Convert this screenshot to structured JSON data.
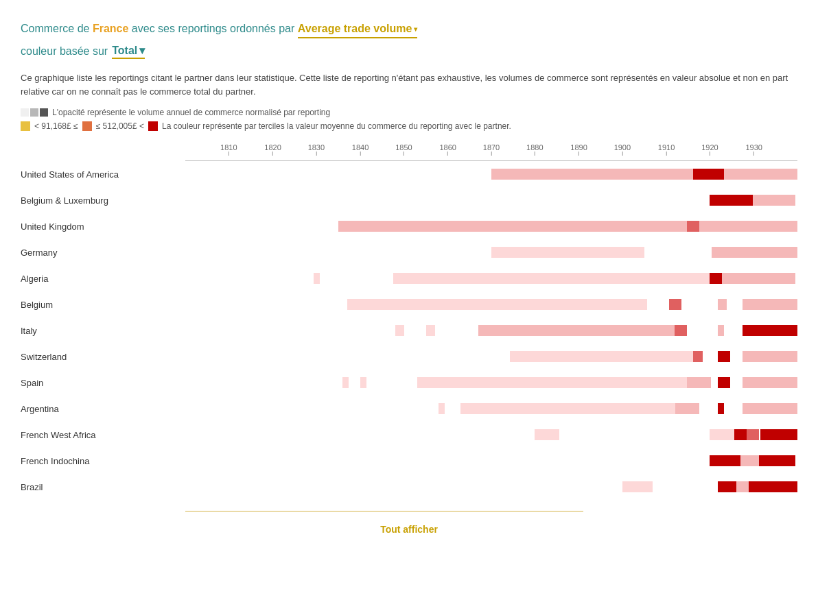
{
  "title": {
    "prefix": "Commerce de ",
    "country": "France",
    "middle": " avec ses reportings ordonnés par",
    "sort_label": "Average trade volume",
    "sort_arrow": "▾",
    "color_prefix": "couleur basée sur",
    "color_value": "Total",
    "color_arrow": "▾"
  },
  "description": "Ce graphique liste les reportings citant le partner dans leur statistique. Cette liste de reporting n'étant pas exhaustive, les volumes de commerce sont représentés en valeur absolue et non en part relative car on ne connaît pas le commerce total du partner.",
  "legend": {
    "opacity_text": "L'opacité représente le volume annuel de commerce normalisé par reporting",
    "color_text": "La couleur représente par terciles la valeur moyenne du commerce du reporting avec le partner.",
    "threshold1": "< 91,168£ ≤",
    "threshold2": "≤ 512,005£ <"
  },
  "timeline": {
    "ticks": [
      "1810",
      "1820",
      "1830",
      "1840",
      "1850",
      "1860",
      "1870",
      "1880",
      "1890",
      "1900",
      "1910",
      "1920",
      "1930"
    ]
  },
  "countries": [
    {
      "name": "United States of America"
    },
    {
      "name": "Belgium & Luxemburg"
    },
    {
      "name": "United Kingdom"
    },
    {
      "name": "Germany"
    },
    {
      "name": "Algeria"
    },
    {
      "name": "Belgium"
    },
    {
      "name": "Italy"
    },
    {
      "name": "Switzerland"
    },
    {
      "name": "Spain"
    },
    {
      "name": "Argentina"
    },
    {
      "name": "French West Africa"
    },
    {
      "name": "French Indochina"
    },
    {
      "name": "Brazil"
    }
  ],
  "show_all": "Tout afficher"
}
